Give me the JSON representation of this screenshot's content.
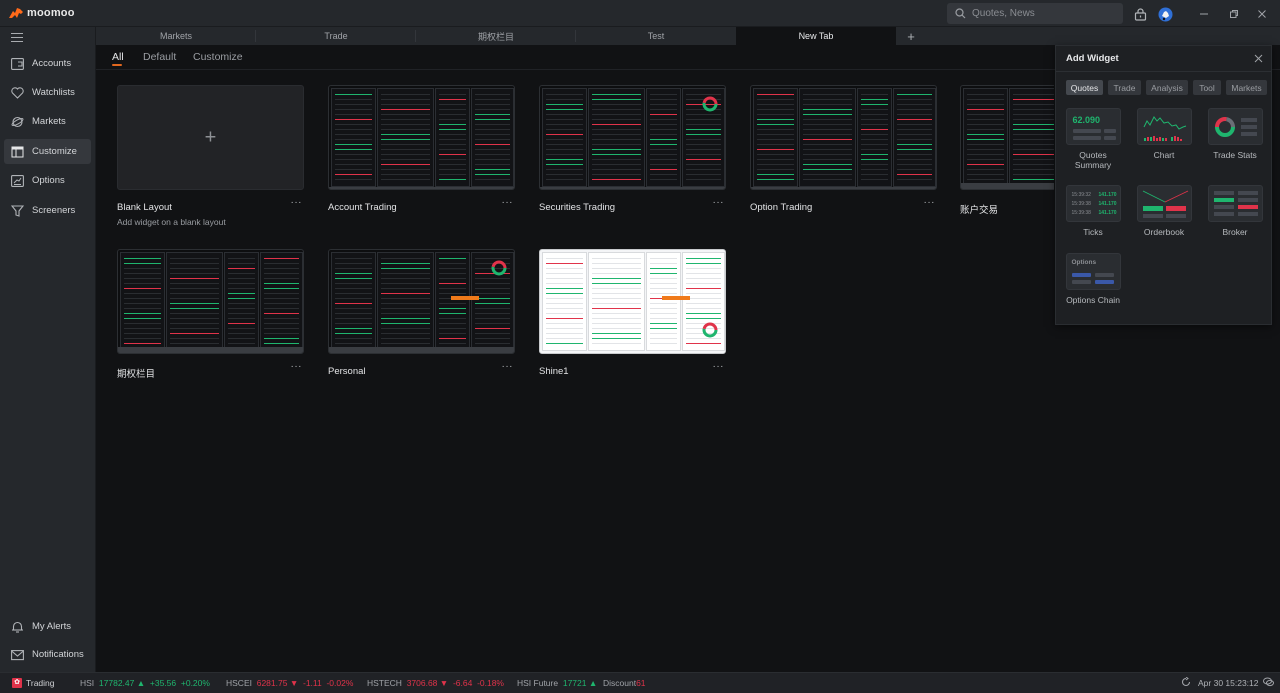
{
  "app": {
    "brand": "moomoo",
    "brand_color": "#ff6a1a",
    "search_placeholder": "Quotes, News"
  },
  "window_controls": {
    "minimize": "minimize-icon",
    "restore": "restore-icon",
    "close": "close-icon"
  },
  "sidebar": {
    "items": [
      {
        "label": "Accounts",
        "icon": "wallet-icon"
      },
      {
        "label": "Watchlists",
        "icon": "heart-icon"
      },
      {
        "label": "Markets",
        "icon": "planet-icon"
      },
      {
        "label": "Customize",
        "icon": "layout-icon",
        "active": true
      },
      {
        "label": "Options",
        "icon": "options-icon"
      },
      {
        "label": "Screeners",
        "icon": "filter-icon"
      }
    ],
    "bottom": [
      {
        "label": "My Alerts",
        "icon": "bell-icon"
      },
      {
        "label": "Notifications",
        "icon": "mail-icon"
      }
    ]
  },
  "tabs": [
    {
      "label": "Markets"
    },
    {
      "label": "Trade"
    },
    {
      "label": "期权栏目"
    },
    {
      "label": "Test"
    },
    {
      "label": "New Tab",
      "active": true
    }
  ],
  "subtabs": [
    {
      "label": "All",
      "active": true
    },
    {
      "label": "Default"
    },
    {
      "label": "Customize"
    }
  ],
  "layouts": [
    {
      "title": "Blank Layout",
      "desc": "Add widget on a blank layout",
      "more": "···"
    },
    {
      "title": "Account Trading",
      "more": "···"
    },
    {
      "title": "Securities Trading",
      "more": "···"
    },
    {
      "title": "Option Trading",
      "more": "···"
    },
    {
      "title": "账户交易"
    },
    {
      "title": "期权栏目",
      "more": "···"
    },
    {
      "title": "Personal",
      "more": "···"
    },
    {
      "title": "Shine1",
      "more": "···"
    }
  ],
  "add_widget": {
    "title": "Add Widget",
    "categories": [
      {
        "label": "Quotes",
        "active": true
      },
      {
        "label": "Trade"
      },
      {
        "label": "Analysis"
      },
      {
        "label": "Tool"
      },
      {
        "label": "Markets"
      }
    ],
    "widgets": [
      {
        "label": "Quotes Summary",
        "preview_value": "62.090"
      },
      {
        "label": "Chart"
      },
      {
        "label": "Trade Stats"
      },
      {
        "label": "Ticks",
        "preview_rows": [
          {
            "time": "15:39:32",
            "price": "141.170"
          },
          {
            "time": "15:39:38",
            "price": "141.170"
          },
          {
            "time": "15:39:38",
            "price": "141.170"
          }
        ]
      },
      {
        "label": "Orderbook"
      },
      {
        "label": "Broker"
      },
      {
        "label": "Options Chain",
        "preview_title": "Options"
      }
    ]
  },
  "statusbar": {
    "trading_label": "Trading",
    "indices": [
      {
        "name": "HSI",
        "price": "17782.47",
        "arrow": "▲",
        "change": "+35.56",
        "pct": "+0.20%",
        "dir": "up"
      },
      {
        "name": "HSCEI",
        "price": "6281.75",
        "arrow": "▼",
        "change": "-1.11",
        "pct": "-0.02%",
        "dir": "down"
      },
      {
        "name": "HSTECH",
        "price": "3706.68",
        "arrow": "▼",
        "change": "-6.64",
        "pct": "-0.18%",
        "dir": "down"
      }
    ],
    "future": {
      "name": "HSI Future",
      "price": "17721",
      "arrow": "▲"
    },
    "discount": {
      "label": "Discount",
      "value": "61"
    },
    "datetime": "Apr 30 15:23:12"
  },
  "colors": {
    "up": "#1fb56e",
    "down": "#e0334a",
    "accent": "#e2681f"
  }
}
